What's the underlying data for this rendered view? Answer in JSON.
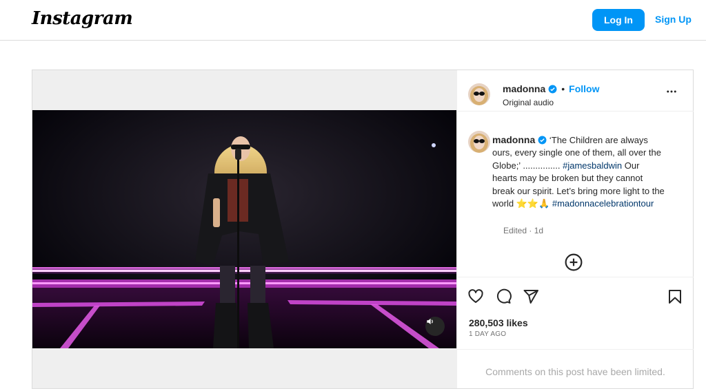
{
  "topbar": {
    "logo_text": "Instagram",
    "login_label": "Log In",
    "signup_label": "Sign Up"
  },
  "post": {
    "username": "madonna",
    "follow_label": "Follow",
    "separator": "•",
    "audio_label": "Original audio",
    "caption_username": "madonna",
    "caption_text_1": "‘The Children are always ours, every single one of them, all over the Globe;’ ............... ",
    "caption_hashtag_1": "#jamesbaldwin",
    "caption_text_2": " Our hearts may be broken but they cannot break our spirit. Let’s bring more light to the world ",
    "caption_emoji": "⭐⭐🙏",
    "caption_hashtag_2": "#madonnacelebrationtour",
    "edited_label": "Edited · 1d",
    "likes": "280,503 likes",
    "date": "1 DAY AGO",
    "comments_limited": "Comments on this post have been limited."
  },
  "colors": {
    "accent": "#0095f6",
    "hashtag": "#00376b",
    "border": "#dbdbdb"
  },
  "icons": [
    "verified-badge-icon",
    "more-options-icon",
    "load-more-comments-icon",
    "heart-icon",
    "comment-icon",
    "share-icon",
    "save-icon",
    "audio-toggle-icon"
  ]
}
